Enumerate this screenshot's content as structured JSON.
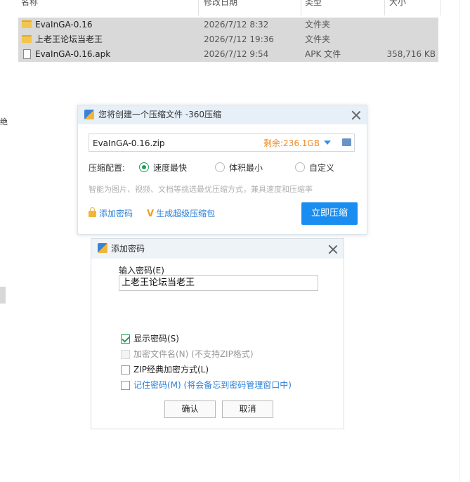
{
  "explorer": {
    "columns": {
      "name": "名称",
      "date": "修改日期",
      "type": "类型",
      "size": "大小"
    },
    "files": [
      {
        "name": "EvaInGA-0.16",
        "date": "2026/7/12 8:32",
        "type": "文件夹",
        "size": "",
        "icon": "folder-icon"
      },
      {
        "name": "上老王论坛当老王",
        "date": "2026/7/12 19:36",
        "type": "文件夹",
        "size": "",
        "icon": "folder-icon"
      },
      {
        "name": "EvaInGA-0.16.apk",
        "date": "2026/7/12 9:54",
        "type": "APK 文件",
        "size": "358,716 KB",
        "icon": "file-icon"
      }
    ],
    "edge_text": "绝"
  },
  "compress_dialog": {
    "title": "您将创建一个压缩文件 -360压缩",
    "filename": "EvaInGA-0.16.zip",
    "remaining": "剩余:236.1GB",
    "config_label": "压缩配置:",
    "options": [
      "速度最快",
      "体积最小",
      "自定义"
    ],
    "selected_option": "速度最快",
    "hint": "智能为图片、视频、文档等挑选最优压缩方式，兼具速度和压缩率",
    "add_password": "添加密码",
    "super_package": "生成超级压缩包",
    "compress_button": "立即压缩"
  },
  "password_dialog": {
    "title": "添加密码",
    "input_label": "输入密码(E)",
    "password_value": "上老王论坛当老王",
    "show_password": "显示密码(S)",
    "encrypt_filename": "加密文件名(N) (不支持ZIP格式)",
    "zip_classic": "ZIP经典加密方式(L)",
    "remember": "记住密码(M) (将会备忘到密码管理窗口中)",
    "show_password_checked": true,
    "ok": "确认",
    "cancel": "取消"
  },
  "colors": {
    "accent": "#1a8ef0",
    "remaining": "#f08a24",
    "check_green": "#21a05a"
  }
}
